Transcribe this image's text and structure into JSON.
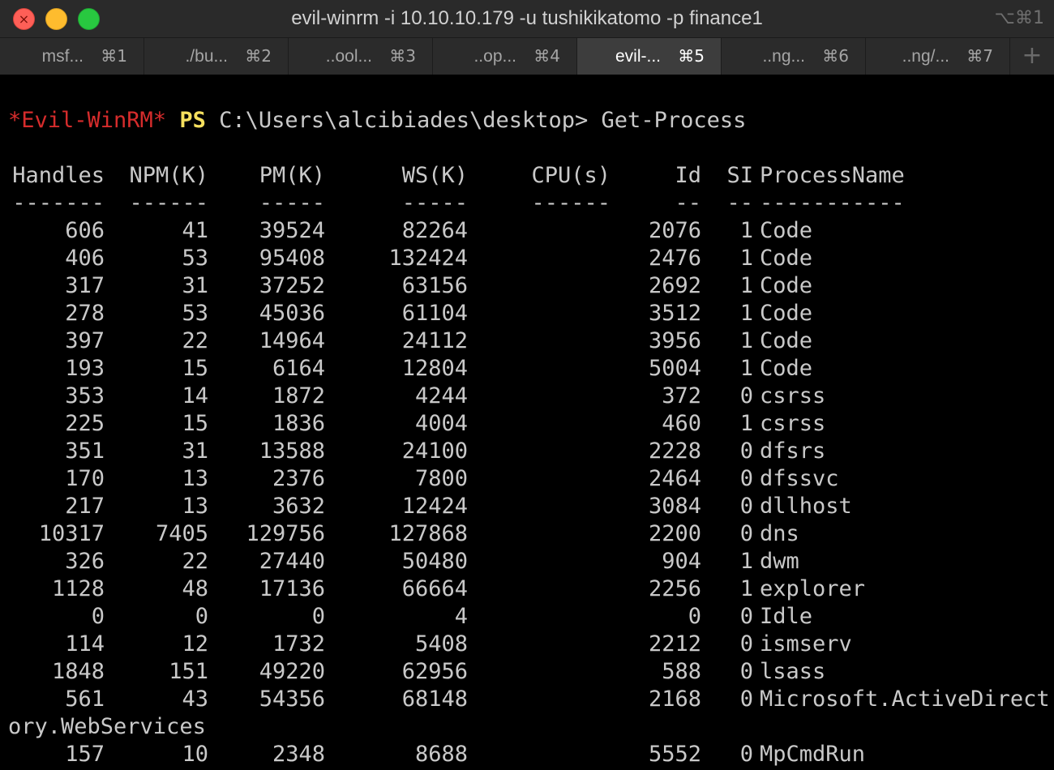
{
  "window": {
    "title": "evil-winrm -i 10.10.10.179 -u tushikikatomo -p finance1",
    "title_shortcut": "⌥⌘1"
  },
  "tabs": [
    {
      "label": "msf...",
      "key": "⌘1",
      "active": false
    },
    {
      "label": "./bu...",
      "key": "⌘2",
      "active": false
    },
    {
      "label": "..ool...",
      "key": "⌘3",
      "active": false
    },
    {
      "label": "..op...",
      "key": "⌘4",
      "active": false
    },
    {
      "label": "evil-...",
      "key": "⌘5",
      "active": true
    },
    {
      "label": "..ng...",
      "key": "⌘6",
      "active": false
    },
    {
      "label": "..ng/...",
      "key": "⌘7",
      "active": false
    }
  ],
  "tab_add_label": "+",
  "prompt": {
    "shell": "*Evil-WinRM*",
    "ps": "PS",
    "path": "C:\\Users\\alcibiades\\desktop>",
    "command": "Get-Process"
  },
  "table": {
    "headers": [
      "Handles",
      "NPM(K)",
      "PM(K)",
      "WS(K)",
      "CPU(s)",
      "Id",
      "SI",
      "ProcessName"
    ],
    "underlines": [
      "-------",
      "------",
      "-----",
      "-----",
      "------",
      "--",
      "--",
      "-----------"
    ],
    "rows": [
      [
        "606",
        "41",
        "39524",
        "82264",
        "",
        "2076",
        "1",
        "Code"
      ],
      [
        "406",
        "53",
        "95408",
        "132424",
        "",
        "2476",
        "1",
        "Code"
      ],
      [
        "317",
        "31",
        "37252",
        "63156",
        "",
        "2692",
        "1",
        "Code"
      ],
      [
        "278",
        "53",
        "45036",
        "61104",
        "",
        "3512",
        "1",
        "Code"
      ],
      [
        "397",
        "22",
        "14964",
        "24112",
        "",
        "3956",
        "1",
        "Code"
      ],
      [
        "193",
        "15",
        "6164",
        "12804",
        "",
        "5004",
        "1",
        "Code"
      ],
      [
        "353",
        "14",
        "1872",
        "4244",
        "",
        "372",
        "0",
        "csrss"
      ],
      [
        "225",
        "15",
        "1836",
        "4004",
        "",
        "460",
        "1",
        "csrss"
      ],
      [
        "351",
        "31",
        "13588",
        "24100",
        "",
        "2228",
        "0",
        "dfsrs"
      ],
      [
        "170",
        "13",
        "2376",
        "7800",
        "",
        "2464",
        "0",
        "dfssvc"
      ],
      [
        "217",
        "13",
        "3632",
        "12424",
        "",
        "3084",
        "0",
        "dllhost"
      ],
      [
        "10317",
        "7405",
        "129756",
        "127868",
        "",
        "2200",
        "0",
        "dns"
      ],
      [
        "326",
        "22",
        "27440",
        "50480",
        "",
        "904",
        "1",
        "dwm"
      ],
      [
        "1128",
        "48",
        "17136",
        "66664",
        "",
        "2256",
        "1",
        "explorer"
      ],
      [
        "0",
        "0",
        "0",
        "4",
        "",
        "0",
        "0",
        "Idle"
      ],
      [
        "114",
        "12",
        "1732",
        "5408",
        "",
        "2212",
        "0",
        "ismserv"
      ],
      [
        "1848",
        "151",
        "49220",
        "62956",
        "",
        "588",
        "0",
        "lsass"
      ],
      [
        "561",
        "43",
        "54356",
        "68148",
        "",
        "2168",
        "0",
        "Microsoft.ActiveDirect"
      ]
    ],
    "wrap_continuation": "ory.WebServices",
    "last_row": [
      "157",
      "10",
      "2348",
      "8688",
      "",
      "5552",
      "0",
      "MpCmdRun"
    ]
  }
}
